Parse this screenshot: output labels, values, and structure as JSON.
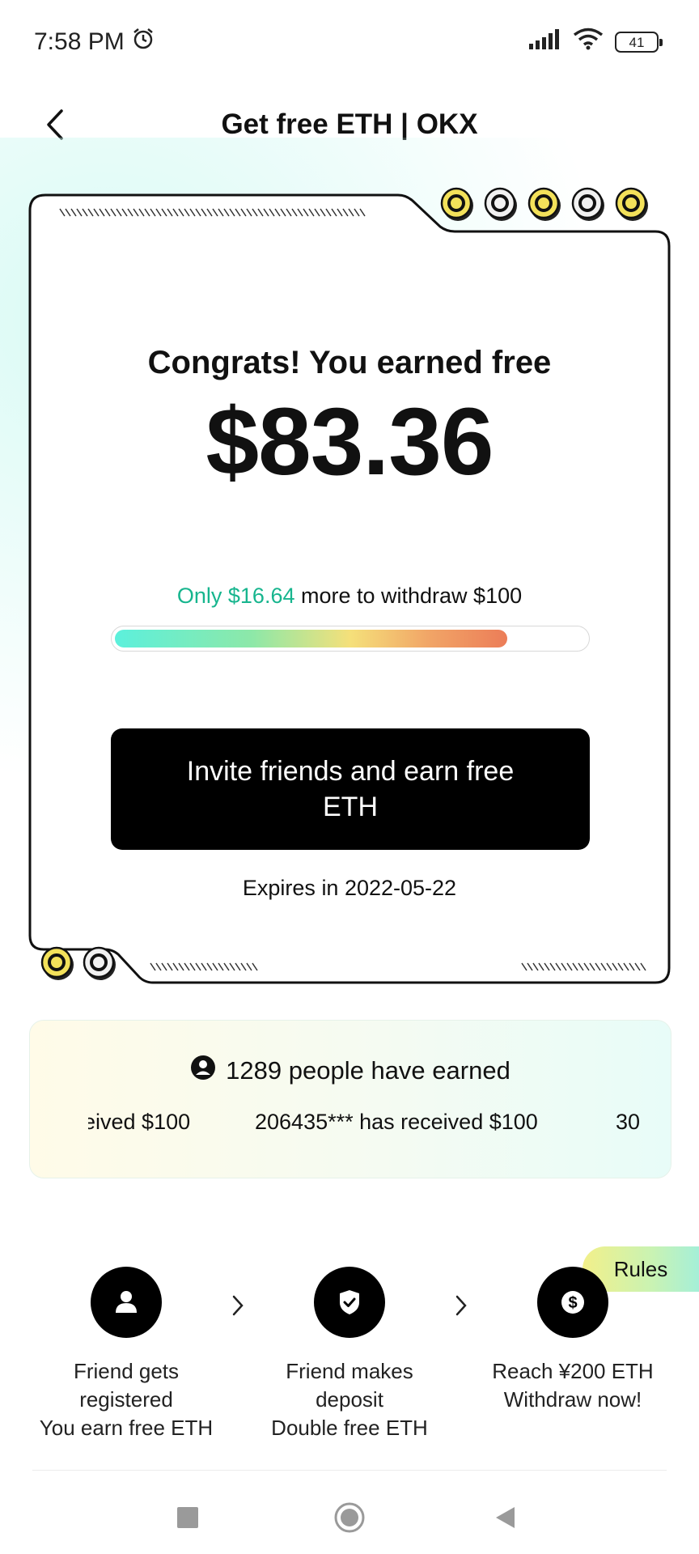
{
  "status_bar": {
    "time": "7:58 PM",
    "battery": "41",
    "icons": [
      "alarm-icon",
      "signal-icon",
      "wifi-icon",
      "battery-icon"
    ]
  },
  "header": {
    "title": "Get free ETH | OKX",
    "back_icon": "back-arrow-icon"
  },
  "card": {
    "congrats": "Congrats! You earned free",
    "amount": "$83.36",
    "progress_highlight": "Only $16.64",
    "progress_rest": " more to withdraw $100",
    "progress_fraction": 0.8336,
    "invite_button": "Invite friends and earn free ETH",
    "expires": "Expires in 2022-05-22"
  },
  "earned": {
    "title": "1289 people have earned",
    "ticker": [
      "eived $100",
      "206435*** has received $100",
      "30"
    ]
  },
  "steps": [
    {
      "icon": "user-icon",
      "label_lines": [
        "Friend gets",
        "registered",
        "You earn free ETH"
      ]
    },
    {
      "icon": "shield-check-icon",
      "label_lines": [
        "Friend makes",
        "deposit",
        "Double free ETH"
      ]
    },
    {
      "icon": "dollar-coin-icon",
      "label_lines": [
        "Reach ¥200 ETH",
        "Withdraw now!"
      ]
    }
  ],
  "rules_label": "Rules",
  "nav": [
    "recent-apps-icon",
    "home-icon",
    "back-icon"
  ],
  "colors": {
    "accent_green": "#17b58e",
    "button_bg": "#000000",
    "coin_gold": "#f3e15a",
    "progress_start": "#5cf0dc",
    "progress_end": "#ec7d58"
  }
}
